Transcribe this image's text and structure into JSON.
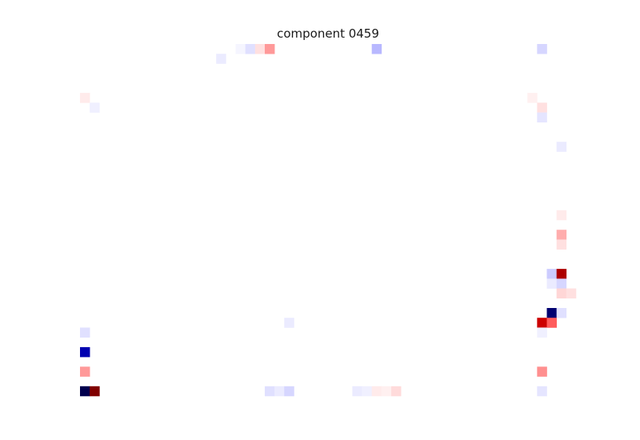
{
  "chart_data": {
    "type": "heatmap",
    "title": "component 0459",
    "xlabel": "",
    "ylabel": "",
    "colormap": "seismic",
    "axes_visible": false,
    "grid": false,
    "rows": 36,
    "cols": 51,
    "vmin": -1,
    "vmax": 1,
    "background_value": 0,
    "cells": [
      {
        "row": 0,
        "col": 16,
        "value": -0.02
      },
      {
        "row": 0,
        "col": 17,
        "value": -0.06
      },
      {
        "row": 0,
        "col": 18,
        "value": 0.06
      },
      {
        "row": 0,
        "col": 19,
        "value": 0.2
      },
      {
        "row": 0,
        "col": 30,
        "value": -0.14
      },
      {
        "row": 0,
        "col": 47,
        "value": -0.08
      },
      {
        "row": 1,
        "col": 14,
        "value": -0.04
      },
      {
        "row": 5,
        "col": 0,
        "value": 0.04
      },
      {
        "row": 5,
        "col": 46,
        "value": 0.03
      },
      {
        "row": 6,
        "col": 1,
        "value": -0.03
      },
      {
        "row": 6,
        "col": 47,
        "value": 0.06
      },
      {
        "row": 7,
        "col": 47,
        "value": -0.05
      },
      {
        "row": 10,
        "col": 49,
        "value": -0.04
      },
      {
        "row": 17,
        "col": 49,
        "value": 0.04
      },
      {
        "row": 19,
        "col": 49,
        "value": 0.16
      },
      {
        "row": 20,
        "col": 49,
        "value": 0.06
      },
      {
        "row": 23,
        "col": 48,
        "value": -0.1
      },
      {
        "row": 23,
        "col": 49,
        "value": 0.82
      },
      {
        "row": 24,
        "col": 48,
        "value": -0.04
      },
      {
        "row": 24,
        "col": 49,
        "value": -0.08
      },
      {
        "row": 25,
        "col": 49,
        "value": 0.08
      },
      {
        "row": 25,
        "col": 50,
        "value": 0.06
      },
      {
        "row": 27,
        "col": 48,
        "value": -0.9
      },
      {
        "row": 27,
        "col": 49,
        "value": -0.06
      },
      {
        "row": 28,
        "col": 47,
        "value": 0.7
      },
      {
        "row": 28,
        "col": 48,
        "value": 0.32
      },
      {
        "row": 28,
        "col": 21,
        "value": -0.04
      },
      {
        "row": 29,
        "col": 0,
        "value": -0.06
      },
      {
        "row": 29,
        "col": 47,
        "value": -0.03
      },
      {
        "row": 31,
        "col": 0,
        "value": -0.72
      },
      {
        "row": 33,
        "col": 0,
        "value": 0.2
      },
      {
        "row": 33,
        "col": 47,
        "value": 0.22
      },
      {
        "row": 35,
        "col": 0,
        "value": -1.0
      },
      {
        "row": 35,
        "col": 1,
        "value": 1.0
      },
      {
        "row": 35,
        "col": 19,
        "value": -0.06
      },
      {
        "row": 35,
        "col": 20,
        "value": -0.04
      },
      {
        "row": 35,
        "col": 21,
        "value": -0.08
      },
      {
        "row": 35,
        "col": 28,
        "value": -0.04
      },
      {
        "row": 35,
        "col": 29,
        "value": -0.03
      },
      {
        "row": 35,
        "col": 30,
        "value": 0.04
      },
      {
        "row": 35,
        "col": 31,
        "value": 0.03
      },
      {
        "row": 35,
        "col": 32,
        "value": 0.07
      },
      {
        "row": 35,
        "col": 47,
        "value": -0.05
      }
    ]
  }
}
